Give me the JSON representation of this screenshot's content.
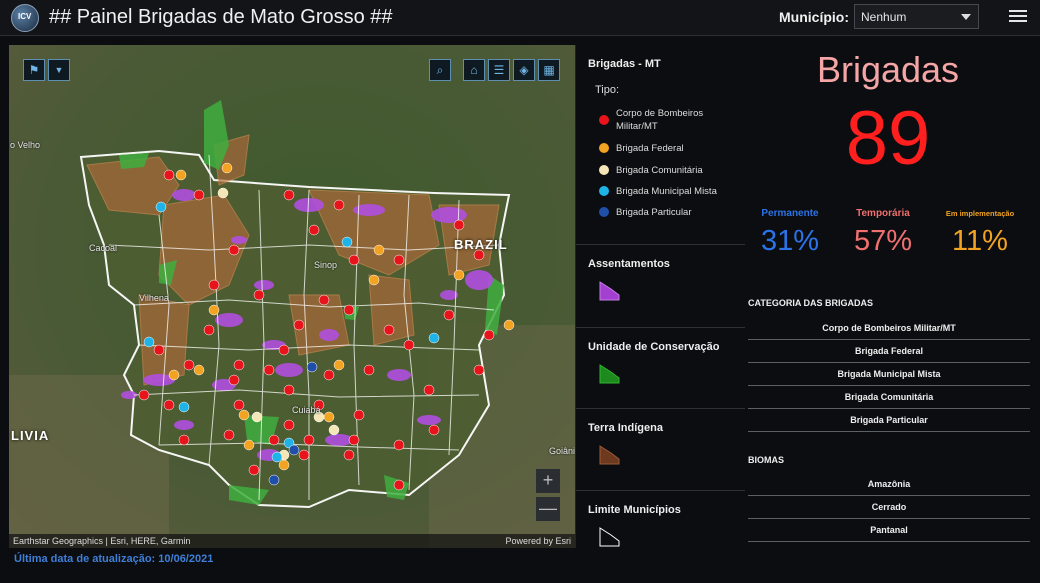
{
  "header": {
    "logo_text": "ICV",
    "title": "## Painel Brigadas de Mato Grosso ##",
    "municipio_label": "Município:",
    "municipio_value": "Nenhum"
  },
  "map": {
    "labels": {
      "brazil": "BRAZIL",
      "bolivia": "LIVIA",
      "porto_velho": "o Velho",
      "cacoal": "Cacoal",
      "vilhena": "Vilhena",
      "sinop": "Sinop",
      "cuiaba": "Cuiabá",
      "goiania": "Goiânia"
    },
    "attribution": "Earthstar Geographics | Esri, HERE, Garmin",
    "powered_by": "Powered by Esri",
    "tools": [
      "filter-icon",
      "chevron-down-icon",
      "search-icon",
      "home-icon",
      "list-icon",
      "layers-icon",
      "qr-icon"
    ],
    "zoom_in": "+",
    "zoom_out": "—"
  },
  "last_update": {
    "label": "Última data de atualização:",
    "date": "10/06/2021"
  },
  "legend": {
    "brigadas_title": "Brigadas - MT",
    "tipo_label": "Tipo:",
    "items": [
      {
        "label": "Corpo de Bombeiros Militar/MT",
        "color": "#e8141c"
      },
      {
        "label": "Brigada Federal",
        "color": "#f2a321"
      },
      {
        "label": "Brigada Comunitária",
        "color": "#f5e6b8"
      },
      {
        "label": "Brigada Municipal Mista",
        "color": "#1fb3e8"
      },
      {
        "label": "Brigada Particular",
        "color": "#1f4fa8"
      }
    ],
    "assentamentos": {
      "title": "Assentamentos",
      "color": "#a33fd1"
    },
    "uc": {
      "title": "Unidade de Conservação",
      "color": "#1e8a1e"
    },
    "ti": {
      "title": "Terra Indígena",
      "color": "#6e3a1f"
    },
    "limite": {
      "title": "Limite Municípios",
      "color": "#ffffff"
    }
  },
  "stats": {
    "title": "Brigadas",
    "total": "89",
    "permanente": {
      "label": "Permanente",
      "value": "31%",
      "color": "#2a73e8"
    },
    "temporaria": {
      "label": "Temporária",
      "value": "57%",
      "color": "#f07070"
    },
    "implementacao": {
      "label": "Em implementação",
      "value": "11%",
      "color": "#f2a321"
    },
    "categoria_title": "CATEGORIA DAS BRIGADAS",
    "categorias": [
      "Corpo de Bombeiros Militar/MT",
      "Brigada Federal",
      "Brigada Municipal Mista",
      "Brigada Comunitária",
      "Brigada Particular"
    ],
    "biomas_title": "BIOMAS",
    "biomas": [
      "Amazônia",
      "Cerrado",
      "Pantanal"
    ]
  }
}
